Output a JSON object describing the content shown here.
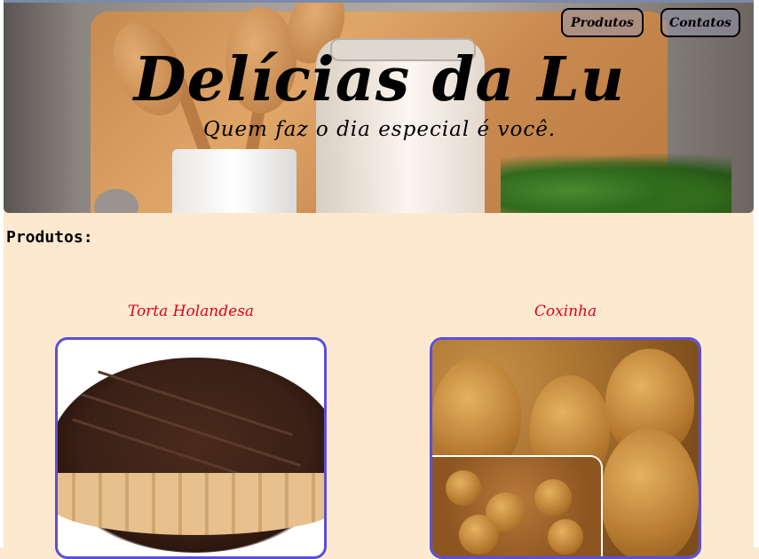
{
  "header": {
    "title": "Delícias da Lu",
    "subtitle": "Quem faz o dia especial é você.",
    "nav": {
      "produtos": "Produtos",
      "contatos": "Contatos"
    }
  },
  "main": {
    "section_title": "Produtos:",
    "products": [
      {
        "name": "Torta Holandesa",
        "image_icon": "torta-holandesa-photo"
      },
      {
        "name": "Coxinha",
        "image_icon": "coxinha-photo"
      }
    ]
  },
  "colors": {
    "page_background": "#fde9d0",
    "product_name": "#e3001b",
    "image_border": "#5c4fd6"
  }
}
